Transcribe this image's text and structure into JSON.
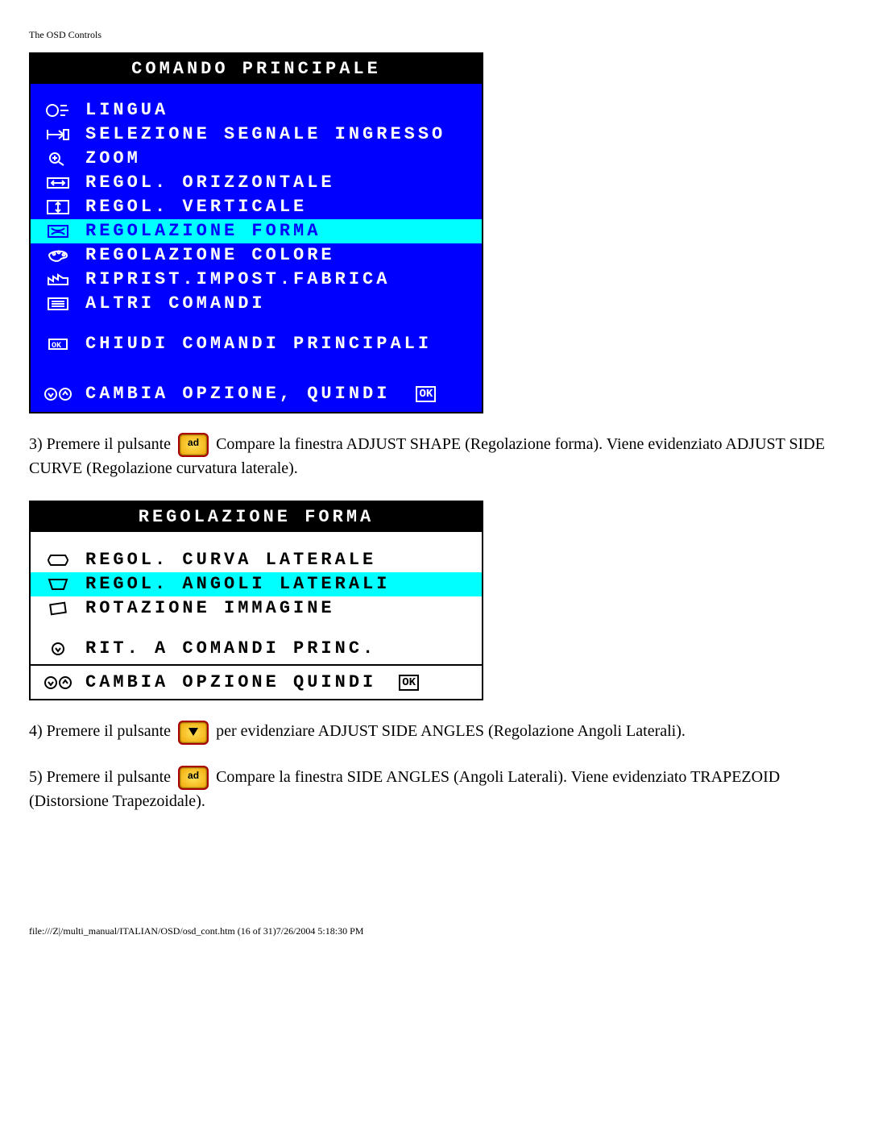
{
  "header": "The OSD Controls",
  "osd1": {
    "title": "COMANDO PRINCIPALE",
    "items": [
      {
        "label": "LINGUA"
      },
      {
        "label": "SELEZIONE SEGNALE INGRESSO"
      },
      {
        "label": "ZOOM"
      },
      {
        "label": "REGOL. ORIZZONTALE"
      },
      {
        "label": "REGOL. VERTICALE"
      },
      {
        "label": "REGOLAZIONE FORMA"
      },
      {
        "label": "REGOLAZIONE COLORE"
      },
      {
        "label": "RIPRIST.IMPOST.FABRICA"
      },
      {
        "label": "ALTRI COMANDI"
      }
    ],
    "close": "CHIUDI COMANDI PRINCIPALI",
    "footer": "CAMBIA OPZIONE, QUINDI",
    "ok": "OK"
  },
  "para3a": "3) Premere il pulsante ",
  "para3b": " Compare la finestra ADJUST SHAPE (Regolazione forma). Viene evidenziato ADJUST SIDE CURVE (Regolazione curvatura laterale).",
  "osd2": {
    "title": "REGOLAZIONE FORMA",
    "items": [
      {
        "label": "REGOL. CURVA LATERALE"
      },
      {
        "label": "REGOL. ANGOLI LATERALI"
      },
      {
        "label": "ROTAZIONE IMMAGINE"
      }
    ],
    "return": "RIT. A COMANDI PRINC.",
    "footer": "CAMBIA OPZIONE QUINDI",
    "ok": "OK"
  },
  "para4a": "4) Premere il pulsante ",
  "para4b": " per evidenziare ADJUST SIDE ANGLES (Regolazione Angoli Laterali).",
  "para5a": "5) Premere il pulsante ",
  "para5b": " Compare la finestra SIDE ANGLES (Angoli Laterali). Viene evidenziato TRAPEZOID (Distorsione Trapezoidale).",
  "footer": "file:///Z|/multi_manual/ITALIAN/OSD/osd_cont.htm (16 of 31)7/26/2004 5:18:30 PM",
  "btn_ok": "ad"
}
